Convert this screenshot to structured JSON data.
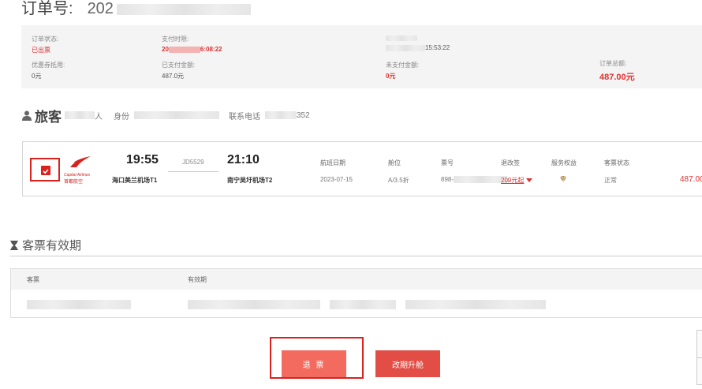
{
  "order": {
    "title_label": "订单号:",
    "number_prefix": "202"
  },
  "summary": {
    "status_label": "订单状态:",
    "status_value": "已出票",
    "pay_time_label": "支付时限:",
    "pay_time_prefix": "20",
    "pay_time_suffix": "6:08:22",
    "book_time_suffix": "15:53:22",
    "coupon_label": "优惠券抵用:",
    "coupon_value": "0元",
    "paid_label": "已支付金额:",
    "paid_value": "487.0元",
    "unpaid_label": "未支付金额:",
    "unpaid_value": "0元",
    "total_label": "订单总额:",
    "total_value": "487.00元"
  },
  "passenger": {
    "section_title": "旅客",
    "person_suffix": "人",
    "id_label": "身份",
    "phone_label": "联系电话",
    "phone_tail": "352"
  },
  "flight": {
    "airline_en": "Capital Airlines",
    "airline_cn": "首都航空",
    "dep_time": "19:55",
    "arr_time": "21:10",
    "flight_no": "JD5529",
    "dep_airport": "海口美兰机场T1",
    "arr_airport": "南宁吴圩机场T2",
    "columns": {
      "date": "航班日期",
      "cabin": "舱位",
      "ticket_no": "票号",
      "change": "退改签",
      "service": "服务权益",
      "ticket_status": "客票状态"
    },
    "date": "2023-07-15",
    "cabin": "A/3.5折",
    "ticket_prefix": "898-",
    "ticket_sep": ",",
    "change_fee": "209元起",
    "ticket_status": "正常",
    "price": "487.00"
  },
  "validity": {
    "section_title": "客票有效期",
    "col_ticket": "客票",
    "col_validity": "有效期"
  },
  "buttons": {
    "refund": "退 票",
    "upgrade": "改期升舱"
  },
  "colors": {
    "accent_red": "#e03131",
    "button_red": "#e24d45",
    "refund_button": "#f26b5e",
    "panel_bg": "#f4f4f4"
  }
}
